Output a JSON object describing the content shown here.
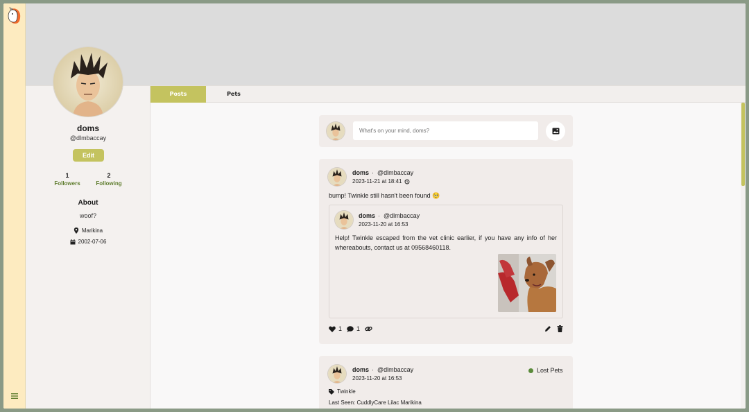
{
  "profile": {
    "display_name": "doms",
    "handle": "@dlmbaccay",
    "edit_label": "Edit",
    "followers_count": "1",
    "followers_label": "Followers",
    "following_count": "2",
    "following_label": "Following",
    "about_heading": "About",
    "bio": "woof?",
    "location": "Marikina",
    "birthday": "2002-07-06"
  },
  "tabs": [
    {
      "label": "Posts",
      "active": true
    },
    {
      "label": "Pets",
      "active": false
    }
  ],
  "composer": {
    "placeholder": "What's on your mind, doms?"
  },
  "posts": [
    {
      "author": "doms",
      "separator": "·",
      "handle": "@dlmbaccay",
      "timestamp": "2023-11-21 at 18:41",
      "text": "bump! Twinkle still hasn't been found 🥺",
      "quoted": {
        "author": "doms",
        "separator": "·",
        "handle": "@dlmbaccay",
        "timestamp": "2023-11-20 at 16:53",
        "text": "Help! Twinkle escaped from the vet clinic earlier, if you have any info of her whereabouts, contact us at 09568460118."
      },
      "likes": "1",
      "comments": "1"
    },
    {
      "author": "doms",
      "separator": "·",
      "handle": "@dlmbaccay",
      "timestamp": "2023-11-20 at 16:53",
      "category": "Lost Pets",
      "pet_tag": "Twinkle",
      "last_seen": "Last Seen: CuddlyCare Lilac Marikina"
    }
  ],
  "colors": {
    "accent": "#c4c35f",
    "rail": "#fdebc0",
    "follow_label": "#5f7d2e",
    "lost_pets_dot": "#5a8a3a"
  }
}
